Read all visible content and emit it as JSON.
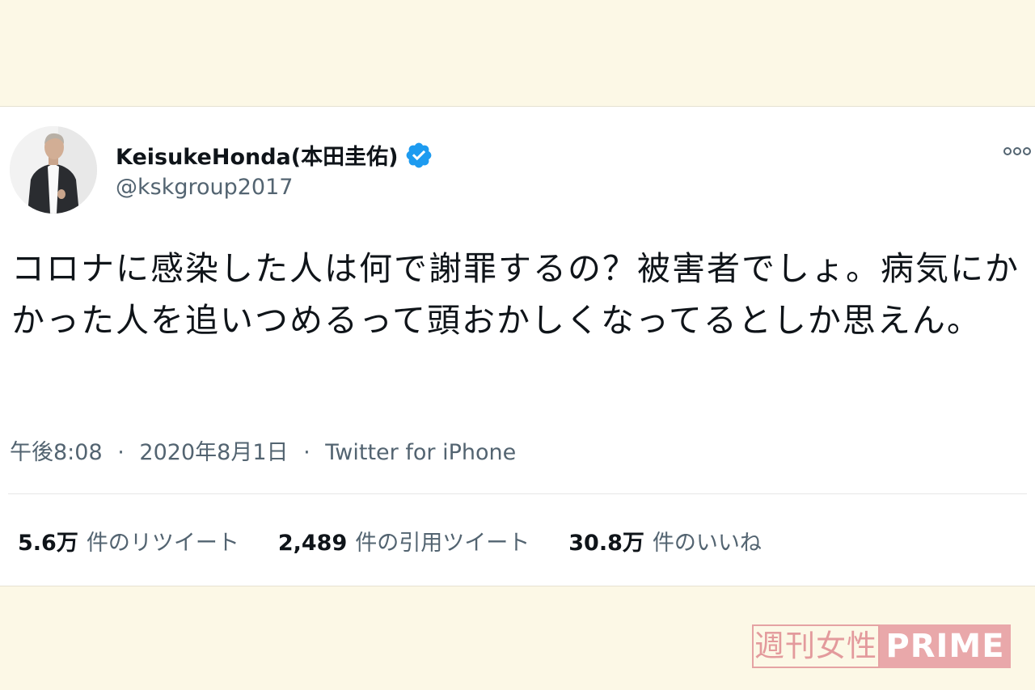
{
  "tweet": {
    "display_name": "KeisukeHonda(本田圭佑)",
    "handle": "@kskgroup2017",
    "text": "コロナに感染した人は何で謝罪するの？被害者でしょ。病気にかかった人を追いつめるって頭おかしくなってるとしか思えん。",
    "time": "午後8:08",
    "date": "2020年8月1日",
    "source": "Twitter for iPhone",
    "meta_separator": "·"
  },
  "stats": {
    "retweets": {
      "value": "5.6万",
      "label": "件のリツイート"
    },
    "quotes": {
      "value": "2,489",
      "label": "件の引用ツイート"
    },
    "likes": {
      "value": "30.8万",
      "label": "件のいいね"
    }
  },
  "watermark": {
    "jp": "週刊女性",
    "en": "PRIME"
  },
  "colors": {
    "background": "#fcf8e6",
    "card": "#ffffff",
    "verified": "#1d9bf0",
    "secondary_text": "#536471",
    "watermark": "#e9a8aa"
  },
  "icons": {
    "verified": "verified-badge-icon",
    "more": "more-options-icon"
  }
}
